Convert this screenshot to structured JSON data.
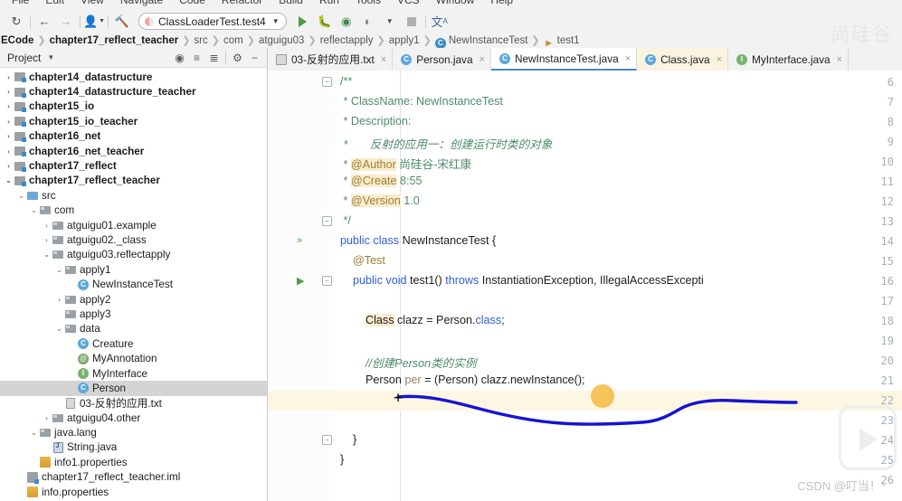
{
  "menu": {
    "items": [
      "File",
      "Edit",
      "View",
      "Navigate",
      "Code",
      "Refactor",
      "Build",
      "Run",
      "Tools",
      "VCS",
      "Window",
      "Help"
    ]
  },
  "toolbar": {
    "sync_icon": "refresh-icon",
    "back_icon": "arrow-left-icon",
    "forward_icon": "arrow-right-icon",
    "user_icon": "user-icon",
    "build_icon": "hammer-icon",
    "run_config": "ClassLoaderTest.test4",
    "run_icon": "run-icon",
    "debug_icon": "debug-icon",
    "run_coverage_icon": "run-with-coverage-icon",
    "profile_icon": "profile-icon",
    "stop_icon": "stop-icon",
    "translate_icon": "translate-icon"
  },
  "breadcrumb": {
    "items": [
      {
        "label": "ECode",
        "bold": true,
        "icon": ""
      },
      {
        "label": "chapter17_reflect_teacher",
        "bold": true,
        "icon": ""
      },
      {
        "label": "src",
        "bold": false,
        "icon": ""
      },
      {
        "label": "com",
        "bold": false,
        "icon": ""
      },
      {
        "label": "atguigu03",
        "bold": false,
        "icon": ""
      },
      {
        "label": "reflectapply",
        "bold": false,
        "icon": ""
      },
      {
        "label": "apply1",
        "bold": false,
        "icon": ""
      },
      {
        "label": "NewInstanceTest",
        "bold": false,
        "icon": "class-icon"
      },
      {
        "label": "test1",
        "bold": false,
        "icon": "method-icon"
      }
    ]
  },
  "project_panel": {
    "title": "Project",
    "caret_icon": "chevron-down-icon",
    "tools": [
      "locate-icon",
      "expand-all-icon",
      "collapse-all-icon",
      "settings-gear-icon",
      "hide-icon"
    ],
    "tree": [
      {
        "label": "chapter14_datastructure",
        "depth": 0,
        "arrow": "collapsed",
        "icon": "module",
        "bold": true
      },
      {
        "label": "chapter14_datastructure_teacher",
        "depth": 0,
        "arrow": "collapsed",
        "icon": "module",
        "bold": true
      },
      {
        "label": "chapter15_io",
        "depth": 0,
        "arrow": "collapsed",
        "icon": "module",
        "bold": true
      },
      {
        "label": "chapter15_io_teacher",
        "depth": 0,
        "arrow": "collapsed",
        "icon": "module",
        "bold": true
      },
      {
        "label": "chapter16_net",
        "depth": 0,
        "arrow": "collapsed",
        "icon": "module",
        "bold": true
      },
      {
        "label": "chapter16_net_teacher",
        "depth": 0,
        "arrow": "collapsed",
        "icon": "module",
        "bold": true
      },
      {
        "label": "chapter17_reflect",
        "depth": 0,
        "arrow": "collapsed",
        "icon": "module",
        "bold": true
      },
      {
        "label": "chapter17_reflect_teacher",
        "depth": 0,
        "arrow": "expanded",
        "icon": "module",
        "bold": true
      },
      {
        "label": "src",
        "depth": 1,
        "arrow": "expanded",
        "icon": "source-folder",
        "bold": false
      },
      {
        "label": "com",
        "depth": 2,
        "arrow": "expanded",
        "icon": "package",
        "bold": false
      },
      {
        "label": "atguigu01.example",
        "depth": 3,
        "arrow": "collapsed",
        "icon": "package",
        "bold": false
      },
      {
        "label": "atguigu02._class",
        "depth": 3,
        "arrow": "collapsed",
        "icon": "package",
        "bold": false
      },
      {
        "label": "atguigu03.reflectapply",
        "depth": 3,
        "arrow": "expanded",
        "icon": "package",
        "bold": false
      },
      {
        "label": "apply1",
        "depth": 4,
        "arrow": "expanded",
        "icon": "package",
        "bold": false
      },
      {
        "label": "NewInstanceTest",
        "depth": 5,
        "arrow": "none",
        "icon": "test-class",
        "bold": false
      },
      {
        "label": "apply2",
        "depth": 4,
        "arrow": "collapsed",
        "icon": "package",
        "bold": false
      },
      {
        "label": "apply3",
        "depth": 4,
        "arrow": "none",
        "icon": "package",
        "bold": false
      },
      {
        "label": "data",
        "depth": 4,
        "arrow": "expanded",
        "icon": "package",
        "bold": false
      },
      {
        "label": "Creature",
        "depth": 5,
        "arrow": "none",
        "icon": "class",
        "bold": false
      },
      {
        "label": "MyAnnotation",
        "depth": 5,
        "arrow": "none",
        "icon": "annotation",
        "bold": false
      },
      {
        "label": "MyInterface",
        "depth": 5,
        "arrow": "none",
        "icon": "interface",
        "bold": false
      },
      {
        "label": "Person",
        "depth": 5,
        "arrow": "none",
        "icon": "class",
        "bold": false,
        "selected": true
      },
      {
        "label": "03-反射的应用.txt",
        "depth": 4,
        "arrow": "none",
        "icon": "text",
        "bold": false
      },
      {
        "label": "atguigu04.other",
        "depth": 3,
        "arrow": "collapsed",
        "icon": "package",
        "bold": false
      },
      {
        "label": "java.lang",
        "depth": 2,
        "arrow": "expanded",
        "icon": "package",
        "bold": false
      },
      {
        "label": "String.java",
        "depth": 3,
        "arrow": "none",
        "icon": "jdk-file",
        "bold": false
      },
      {
        "label": "info1.properties",
        "depth": 2,
        "arrow": "none",
        "icon": "properties",
        "bold": false
      },
      {
        "label": "chapter17_reflect_teacher.iml",
        "depth": 1,
        "arrow": "none",
        "icon": "iml",
        "bold": false
      },
      {
        "label": "info.properties",
        "depth": 1,
        "arrow": "none",
        "icon": "properties",
        "bold": false
      }
    ]
  },
  "editor_tabs": [
    {
      "label": "03-反射的应用.txt",
      "icon": "text-file-icon",
      "active": false,
      "cream": false
    },
    {
      "label": "Person.java",
      "icon": "class-icon",
      "active": false,
      "cream": false
    },
    {
      "label": "NewInstanceTest.java",
      "icon": "test-class-icon",
      "active": true,
      "cream": false
    },
    {
      "label": "Class.java",
      "icon": "class-icon",
      "active": false,
      "cream": true
    },
    {
      "label": "MyInterface.java",
      "icon": "interface-icon",
      "active": false,
      "cream": false
    }
  ],
  "editor": {
    "first_line": 6,
    "lines": [
      {
        "num": 6,
        "text": "/**"
      },
      {
        "num": 7,
        "text": " * ClassName: NewInstanceTest"
      },
      {
        "num": 8,
        "text": " * Description:"
      },
      {
        "num": 9,
        "text": " *       反射的应用一：创建运行时类的对象"
      },
      {
        "num": 10,
        "text": " * @Author 尚硅谷-宋红康"
      },
      {
        "num": 11,
        "text": " * @Create 8:55"
      },
      {
        "num": 12,
        "text": " * @Version 1.0"
      },
      {
        "num": 13,
        "text": " */"
      },
      {
        "num": 14,
        "text": "public class NewInstanceTest {"
      },
      {
        "num": 15,
        "text": "    @Test"
      },
      {
        "num": 16,
        "text": "    public void test1() throws InstantiationException, IllegalAccessExcepti"
      },
      {
        "num": 17,
        "text": ""
      },
      {
        "num": 18,
        "text": "        Class clazz = Person.class;"
      },
      {
        "num": 19,
        "text": ""
      },
      {
        "num": 20,
        "text": "        //创建Person类的实例"
      },
      {
        "num": 21,
        "text": "        Person per = (Person) clazz.newInstance();"
      },
      {
        "num": 22,
        "text": ""
      },
      {
        "num": 23,
        "text": ""
      },
      {
        "num": 24,
        "text": "    }"
      },
      {
        "num": 25,
        "text": "}"
      },
      {
        "num": 26,
        "text": ""
      }
    ],
    "highlighted_line": 22,
    "caret_line": 22
  },
  "annotations": {
    "ink_color": "#1414d2",
    "cursor_dot_color": "#f5b942"
  },
  "watermarks": {
    "top_right": "尚硅谷",
    "bottom_right": "CSDN @叮当！*"
  }
}
